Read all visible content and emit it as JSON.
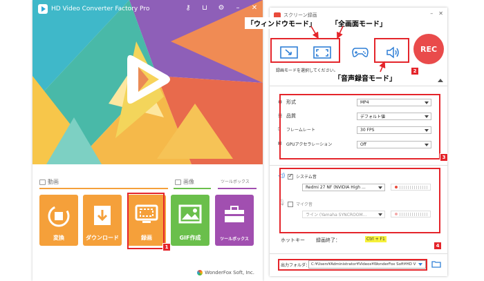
{
  "left_window": {
    "title": "HD Video Converter Factory Pro",
    "sections": {
      "video": "動画",
      "image": "画像",
      "toolbox": "ツールボックス"
    },
    "tiles": [
      {
        "label": "変換",
        "color": "#f5a03a"
      },
      {
        "label": "ダウンロード",
        "color": "#f5a03a"
      },
      {
        "label": "録画",
        "color": "#f5a03a"
      },
      {
        "label": "GIF作成",
        "color": "#6abf4b"
      },
      {
        "label": "ツールボックス",
        "color": "#a14fb0"
      }
    ],
    "footer": "WonderFox Soft, Inc."
  },
  "recorder": {
    "title": "スクリーン録画",
    "rec_label": "REC",
    "mode_hint": "録画モードを選択してください。",
    "format": {
      "label": "形式",
      "value": "MP4"
    },
    "quality": {
      "label": "品質",
      "value": "デフォルト値"
    },
    "framerate": {
      "label": "フレームレート",
      "value": "30 FPS"
    },
    "gpu": {
      "label": "GPUアクセラレーション",
      "value": "Off"
    },
    "system_audio": {
      "label": "システム音",
      "device": "Redmi 27 NF (NVIDIA High ..."
    },
    "mic": {
      "label": "マイク音",
      "device": "ライン (Yamaha SYNCROOM..."
    },
    "hotkey": {
      "label": "ホットキー",
      "action": "録画終了：",
      "key": "Ctrl + F1"
    },
    "output": {
      "label": "出力フォルダ：",
      "path": "C:¥Users¥Administrator¥Videos¥WonderFox Soft¥HD V"
    }
  },
  "annotations": {
    "window_mode": "「ウィンドウモード」",
    "fullscreen_mode": "「全画面モード」",
    "audio_mode": "「音声録音モード」",
    "badges": [
      "1",
      "2",
      "3",
      "4"
    ]
  },
  "colors": {
    "accent_red": "#e4242a",
    "rec_red": "#e94b4b",
    "link_blue": "#2f7fd6"
  }
}
